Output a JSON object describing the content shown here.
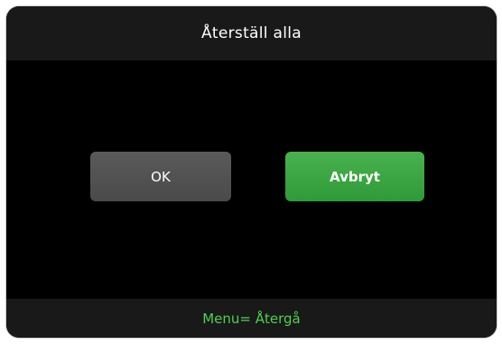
{
  "dialog": {
    "title": "Återställ alla",
    "ok_label": "OK",
    "cancel_label": "Avbryt",
    "footer_hint": "Menu= Återgå"
  },
  "colors": {
    "background": "#000000",
    "title_bar": "#191919",
    "ok_button": "#555555",
    "cancel_button": "#3aa342",
    "hint_text": "#4ed04e"
  }
}
